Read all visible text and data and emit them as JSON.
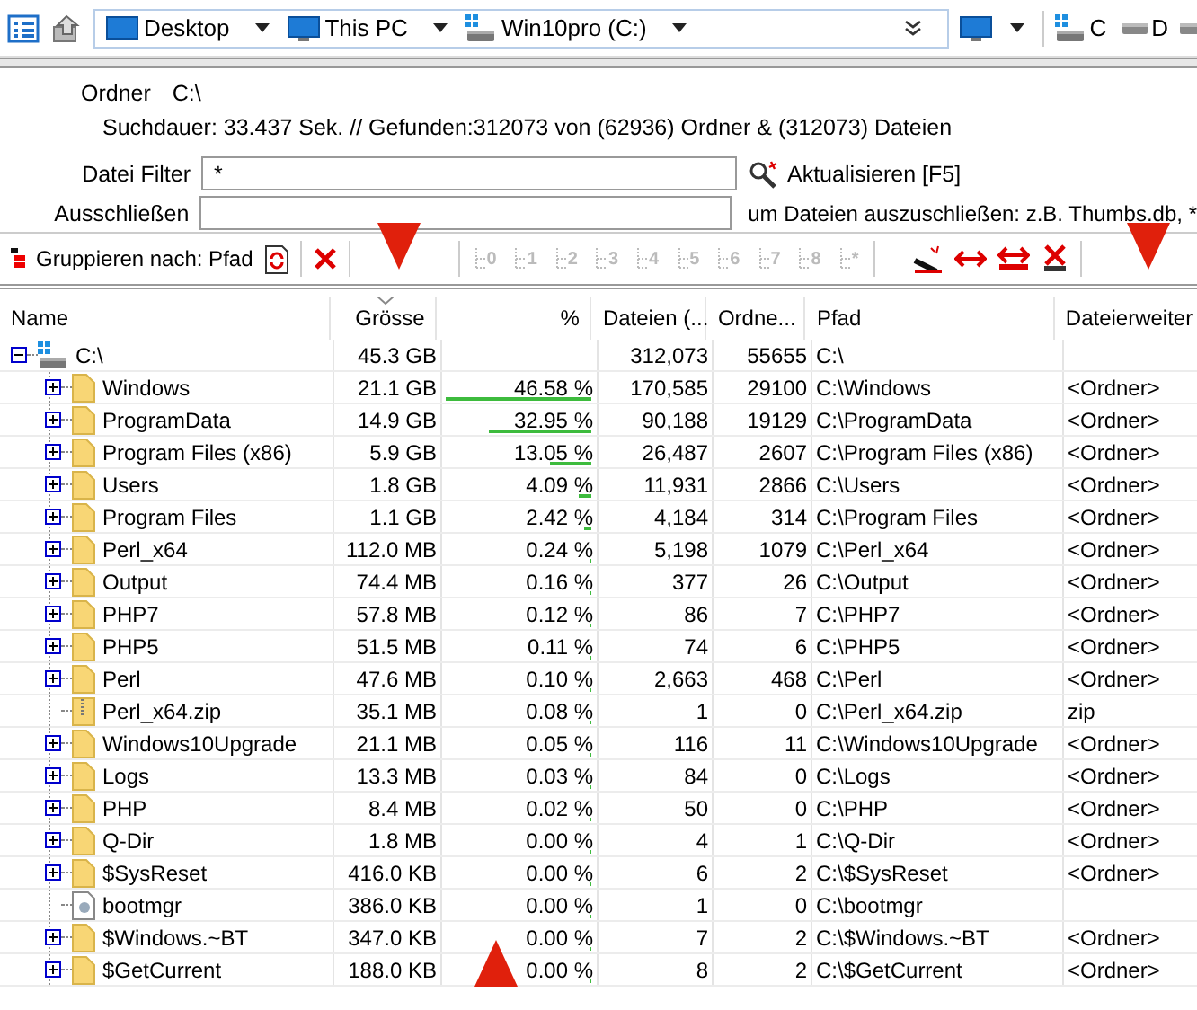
{
  "toolbar": {
    "breadcrumbs": [
      {
        "label": "Desktop",
        "kind": "desktop"
      },
      {
        "label": "This PC",
        "kind": "pc"
      },
      {
        "label": "Win10pro (C:)",
        "kind": "drive"
      }
    ],
    "drives": [
      {
        "label": "C"
      },
      {
        "label": "D"
      }
    ]
  },
  "info": {
    "folder_label": "Ordner",
    "folder": "C:\\",
    "summary": "Suchdauer: 33.437 Sek. //  Gefunden:312073 von (62936) Ordner & (312073) Dateien",
    "filter": {
      "label": "Datei Filter",
      "value": "*"
    },
    "refresh_button": "Aktualisieren [F5]",
    "exclude": {
      "label": "Ausschließen"
    },
    "exclude_hint": "um Dateien auszuschließen: z.B. Thumbs.db, *"
  },
  "group_toolbar": {
    "label": "Gruppieren nach: Pfad",
    "levels": [
      {
        "label": "0",
        "disabled": true
      },
      {
        "label": "1",
        "disabled": true
      },
      {
        "label": "2",
        "disabled": true
      },
      {
        "label": "3",
        "disabled": true
      },
      {
        "label": "4",
        "disabled": true
      },
      {
        "label": "5",
        "disabled": true
      },
      {
        "label": "6",
        "disabled": true
      },
      {
        "label": "7",
        "disabled": true
      },
      {
        "label": "8",
        "disabled": true
      },
      {
        "label": "*",
        "disabled": true
      }
    ]
  },
  "table": {
    "columns": [
      {
        "label": "Name",
        "sorted": false
      },
      {
        "label": "Grösse",
        "sorted": true
      },
      {
        "label": "%",
        "sorted": false
      },
      {
        "label": "Dateien (...",
        "sorted": false
      },
      {
        "label": "Ordne...",
        "sorted": false
      },
      {
        "label": "Pfad",
        "sorted": false
      },
      {
        "label": "Dateierweiter",
        "sorted": false
      }
    ],
    "rows": [
      {
        "kind": "drive",
        "expanded": true,
        "name": "C:\\",
        "size": "45.3 GB",
        "files": "312,073",
        "folders": "55655",
        "path": "C:\\",
        "children": [
          {
            "kind": "folder",
            "expanded": false,
            "name": "Windows",
            "size": "21.1 GB",
            "percent": "46.58 %",
            "level": 1,
            "files": "170,585",
            "folders": "29100",
            "path": "C:\\Windows",
            "type": "<Ordner>"
          },
          {
            "kind": "folder",
            "expanded": false,
            "name": "ProgramData",
            "size": "14.9 GB",
            "percent": "32.95 %",
            "level": 0.71,
            "files": "90,188",
            "folders": "19129",
            "path": "C:\\ProgramData",
            "type": "<Ordner>"
          },
          {
            "kind": "folder",
            "expanded": false,
            "name": "Program Files (x86)",
            "size": "5.9 GB",
            "percent": "13.05 %",
            "level": 0.28,
            "files": "26,487",
            "folders": "2607",
            "path": "C:\\Program Files (x86)",
            "type": "<Ordner>"
          },
          {
            "kind": "folder",
            "expanded": false,
            "name": "Users",
            "size": "1.8 GB",
            "percent": "4.09 %",
            "level": 0.09,
            "files": "11,931",
            "folders": "2866",
            "path": "C:\\Users",
            "type": "<Ordner>"
          },
          {
            "kind": "folder",
            "expanded": false,
            "name": "Program Files",
            "size": "1.1 GB",
            "percent": "2.42 %",
            "level": 0.05,
            "files": "4,184",
            "folders": "314",
            "path": "C:\\Program Files",
            "type": "<Ordner>"
          },
          {
            "kind": "folder",
            "expanded": false,
            "name": "Perl_x64",
            "size": "112.0 MB",
            "percent": "0.24 %",
            "level": 0.01,
            "files": "5,198",
            "folders": "1079",
            "path": "C:\\Perl_x64",
            "type": "<Ordner>"
          },
          {
            "kind": "folder",
            "expanded": false,
            "name": "Output",
            "size": "74.4 MB",
            "percent": "0.16 %",
            "level": 0.01,
            "files": "377",
            "folders": "26",
            "path": "C:\\Output",
            "type": "<Ordner>"
          },
          {
            "kind": "folder",
            "expanded": false,
            "name": "PHP7",
            "size": "57.8 MB",
            "percent": "0.12 %",
            "level": 0.01,
            "files": "86",
            "folders": "7",
            "path": "C:\\PHP7",
            "type": "<Ordner>"
          },
          {
            "kind": "folder",
            "expanded": false,
            "name": "PHP5",
            "size": "51.5 MB",
            "percent": "0.11 %",
            "level": 0.01,
            "files": "74",
            "folders": "6",
            "path": "C:\\PHP5",
            "type": "<Ordner>"
          },
          {
            "kind": "folder",
            "expanded": false,
            "name": "Perl",
            "size": "47.6 MB",
            "percent": "0.10 %",
            "level": 0.01,
            "files": "2,663",
            "folders": "468",
            "path": "C:\\Perl",
            "type": "<Ordner>"
          },
          {
            "kind": "zip",
            "name": "Perl_x64.zip",
            "size": "35.1 MB",
            "percent": "0.08 %",
            "level": 0.01,
            "files": "1",
            "folders": "0",
            "path": "C:\\Perl_x64.zip",
            "type": "zip"
          },
          {
            "kind": "folder",
            "expanded": false,
            "name": "Windows10Upgrade",
            "size": "21.1 MB",
            "percent": "0.05 %",
            "level": 0.01,
            "files": "116",
            "folders": "11",
            "path": "C:\\Windows10Upgrade",
            "type": "<Ordner>"
          },
          {
            "kind": "folder",
            "expanded": false,
            "name": "Logs",
            "size": "13.3 MB",
            "percent": "0.03 %",
            "level": 0.01,
            "files": "84",
            "folders": "0",
            "path": "C:\\Logs",
            "type": "<Ordner>"
          },
          {
            "kind": "folder",
            "expanded": false,
            "name": "PHP",
            "size": "8.4 MB",
            "percent": "0.02 %",
            "level": 0.01,
            "files": "50",
            "folders": "0",
            "path": "C:\\PHP",
            "type": "<Ordner>"
          },
          {
            "kind": "folder",
            "expanded": false,
            "name": "Q-Dir",
            "size": "1.8 MB",
            "percent": "0.00 %",
            "level": 0.01,
            "files": "4",
            "folders": "1",
            "path": "C:\\Q-Dir",
            "type": "<Ordner>"
          },
          {
            "kind": "folder",
            "expanded": false,
            "name": "$SysReset",
            "size": "416.0 KB",
            "percent": "0.00 %",
            "level": 0.01,
            "files": "6",
            "folders": "2",
            "path": "C:\\$SysReset",
            "type": "<Ordner>"
          },
          {
            "kind": "file",
            "name": "bootmgr",
            "size": "386.0 KB",
            "percent": "0.00 %",
            "level": 0.01,
            "files": "1",
            "folders": "0",
            "path": "C:\\bootmgr"
          },
          {
            "kind": "folder",
            "expanded": false,
            "name": "$Windows.~BT",
            "size": "347.0 KB",
            "percent": "0.00 %",
            "level": 0.01,
            "files": "7",
            "folders": "2",
            "path": "C:\\$Windows.~BT",
            "type": "<Ordner>"
          },
          {
            "kind": "folder",
            "expanded": false,
            "name": "$GetCurrent",
            "size": "188.0 KB",
            "percent": "0.00 %",
            "level": 0.01,
            "files": "8",
            "folders": "2",
            "path": "C:\\$GetCurrent",
            "type": "<Ordner>"
          }
        ]
      }
    ]
  }
}
